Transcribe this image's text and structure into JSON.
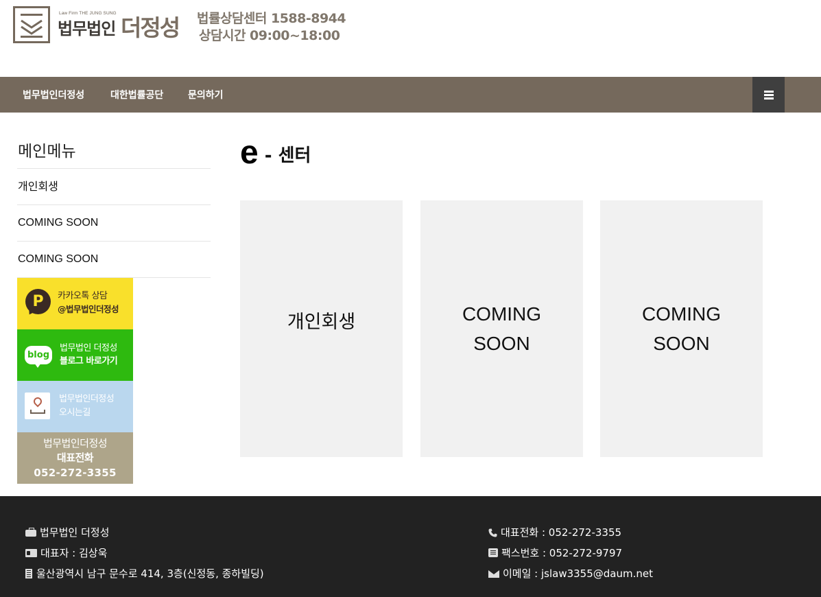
{
  "header": {
    "logo_sub": "Law Firm THE JUNG SUNG",
    "logo_name_primary": "법무법인",
    "logo_name_secondary": "더정성",
    "hotline_line1": "법률상담센터 1588-8944",
    "hotline_line2": "상담시간  09:00~18:00"
  },
  "nav": {
    "items": [
      {
        "label": "법무법인더정성"
      },
      {
        "label": "대한법률공단"
      },
      {
        "label": "문의하기"
      }
    ],
    "menu_icon": "hamburger-icon"
  },
  "sidebar": {
    "title": "메인메뉴",
    "items": [
      {
        "label": "개인회생"
      },
      {
        "label": "COMING SOON"
      },
      {
        "label": "COMING SOON"
      }
    ],
    "banners": {
      "kakao": {
        "line1": "카카오톡 상담",
        "line2": "@법무법인더정성",
        "icon": "kakao-p-icon",
        "color": "#f9e02b"
      },
      "blog": {
        "icon_text": "blog",
        "line1": "법무법인 더정성",
        "line2": "블로그 바로가기",
        "icon": "blog-icon",
        "color": "#2eba0f"
      },
      "map": {
        "line1": "법무법인더정성",
        "line2": "오시는길",
        "icon": "map-pin-icon",
        "color": "#bad7ee"
      },
      "phone": {
        "line1": "법무법인더정성",
        "line2": "대표전화",
        "line3": "052-272-3355",
        "color": "#aea58a"
      }
    }
  },
  "main": {
    "title_prefix": "e",
    "title_rest": " - 센터",
    "cards": [
      {
        "line1": "개인회생",
        "line2": ""
      },
      {
        "line1": "COMING",
        "line2": "SOON"
      },
      {
        "line1": "COMING",
        "line2": "SOON"
      }
    ]
  },
  "footer": {
    "left": [
      {
        "icon": "briefcase-icon",
        "text": "법무법인 더정성"
      },
      {
        "icon": "id-card-icon",
        "text": "대표자 : 김상욱"
      },
      {
        "icon": "building-icon",
        "text": "울산광역시 남구 문수로 414, 3층(신정동, 종하빌딩)"
      }
    ],
    "right": [
      {
        "icon": "phone-icon",
        "text": "대표전화 : 052-272-3355"
      },
      {
        "icon": "fax-icon",
        "text": "팩스번호 : 052-272-9797"
      },
      {
        "icon": "envelope-icon",
        "text": "이메일 : jslaw3355@daum.net"
      }
    ]
  },
  "colors": {
    "brand": "#75695c",
    "footer_bg": "#222222",
    "card_bg": "#f1f1f1"
  }
}
